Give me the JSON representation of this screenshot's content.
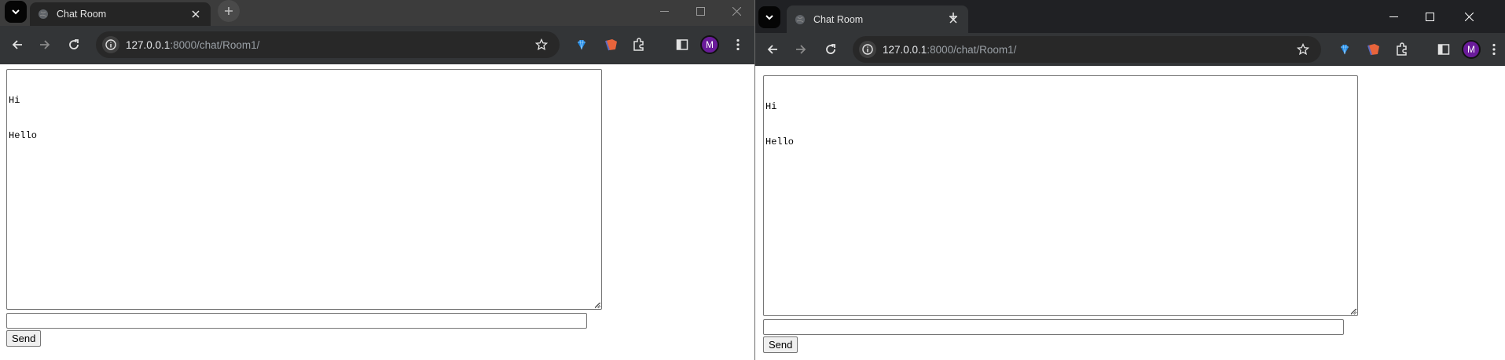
{
  "windows": [
    {
      "tab": {
        "title": "Chat Room"
      },
      "address": {
        "host": "127.0.0.1",
        "rest": ":8000/chat/Room1/"
      },
      "profile_initial": "M",
      "chat": {
        "messages": [
          "Hi",
          "Hello"
        ],
        "input_value": "",
        "send_label": "Send"
      }
    },
    {
      "tab": {
        "title": "Chat Room"
      },
      "address": {
        "host": "127.0.0.1",
        "rest": ":8000/chat/Room1/"
      },
      "profile_initial": "M",
      "chat": {
        "messages": [
          "Hi",
          "Hello"
        ],
        "input_value": "",
        "send_label": "Send"
      }
    }
  ],
  "colors": {
    "titlebar": "#202124",
    "toolbar": "#333537",
    "avatar": "#6a1b9a",
    "extension_diamond": "#1e88e5",
    "extension_brave": "#e8643b"
  }
}
